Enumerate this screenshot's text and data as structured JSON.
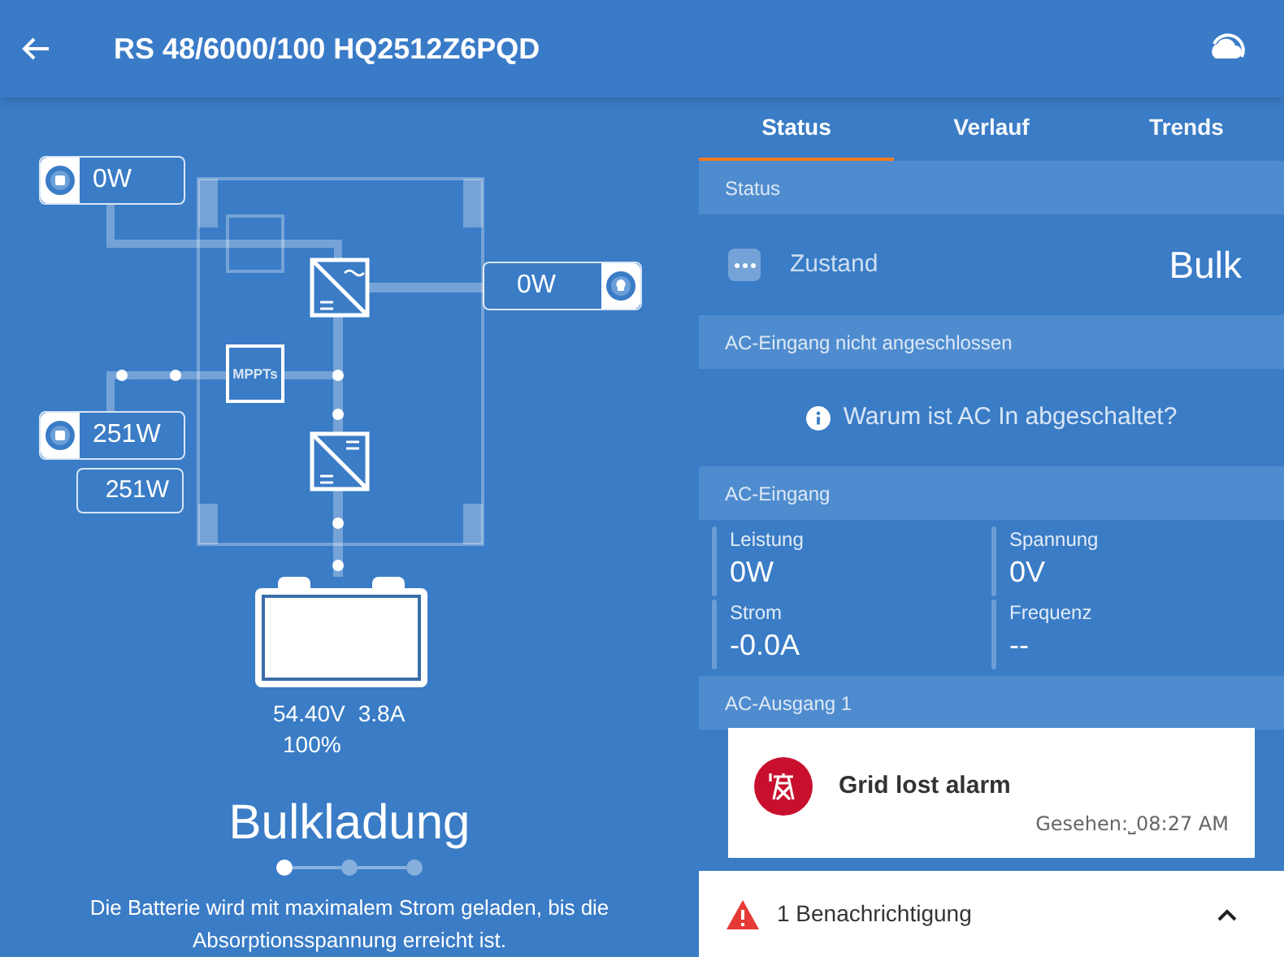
{
  "header": {
    "title": "RS 48/6000/100 HQ2512Z6PQD"
  },
  "diagram": {
    "ac_input": {
      "reading": "0W"
    },
    "ac_output": {
      "reading": "0W"
    },
    "solar": {
      "reading": "251W",
      "total": "251W"
    },
    "mppt_label": "MPPTs",
    "battery": {
      "voltage": "54.40V",
      "current": "3.8A",
      "soc": "100%",
      "level": 1
    }
  },
  "charge_state": {
    "title": "Bulkladung",
    "steps": [
      {
        "selected": true
      },
      {
        "selected": false
      },
      {
        "selected": false
      }
    ],
    "description": "Die Batterie wird mit maximalem Strom geladen, bis die Absorptionsspannung erreicht ist."
  },
  "tabs": [
    {
      "label": "Status",
      "selected": true
    },
    {
      "label": "Verlauf",
      "selected": false
    },
    {
      "label": "Trends",
      "selected": false
    }
  ],
  "sections": [
    {
      "title": "Status",
      "kind": "state",
      "label": "Zustand",
      "value": "Bulk"
    },
    {
      "title": "AC-Eingang nicht angeschlossen",
      "kind": "info",
      "text": "Warum ist AC In abgeschaltet?"
    },
    {
      "title": "AC-Eingang",
      "kind": "grid",
      "cells": [
        {
          "label": "Leistung",
          "value": "0W"
        },
        {
          "label": "Spannung",
          "value": "0V"
        },
        {
          "label": "Strom",
          "value": "-0.0A"
        },
        {
          "label": "Frequenz",
          "value": "--"
        }
      ]
    },
    {
      "title": "AC-Ausgang 1",
      "kind": "covered"
    }
  ],
  "notification": {
    "title": "Grid lost alarm",
    "seen": "Gesehen:⎵08:27 AM"
  },
  "bottom_bar": {
    "text": "1 Benachrichtigung"
  }
}
